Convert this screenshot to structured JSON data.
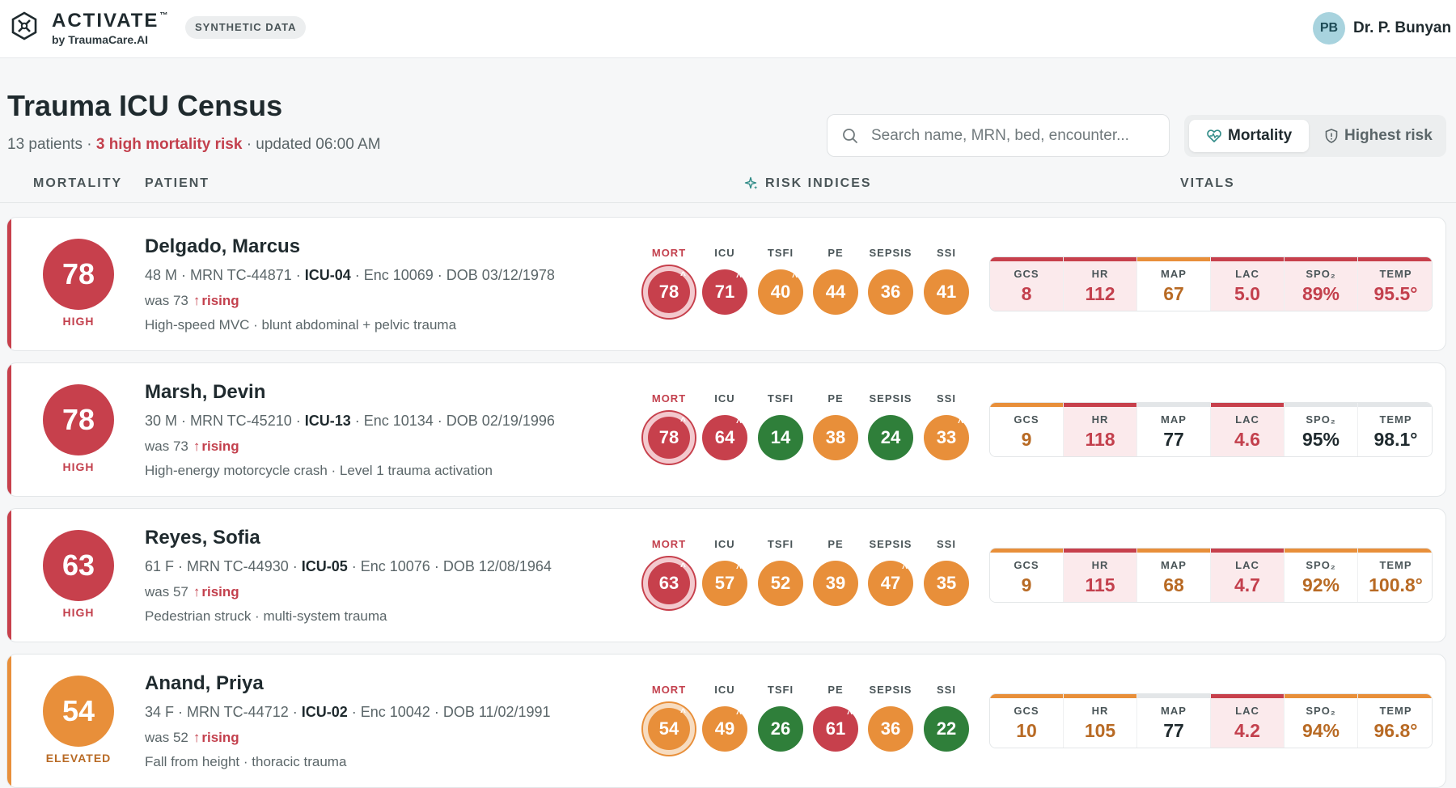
{
  "app": {
    "brand": "ACTIVATE",
    "trademark": "™",
    "brand_sub": "by TraumaCare.AI",
    "badge": "SYNTHETIC DATA"
  },
  "user": {
    "initials": "PB",
    "name": "Dr. P. Bunyan"
  },
  "page": {
    "title": "Trauma ICU Census",
    "patient_count": "13 patients",
    "sep": "·",
    "high_risk": "3 high mortality risk",
    "updated": "updated 06:00 AM"
  },
  "search": {
    "placeholder": "Search name, MRN, bed, encounter..."
  },
  "sort": {
    "mortality": "Mortality",
    "highest_risk": "Highest risk"
  },
  "columns": {
    "mortality": "MORTALITY",
    "patient": "PATIENT",
    "risk": "RISK INDICES",
    "vitals": "VITALS"
  },
  "index_labels": [
    "MORT",
    "ICU",
    "TSFI",
    "PE",
    "SEPSIS",
    "SSI"
  ],
  "vital_labels": [
    "GCS",
    "HR",
    "MAP",
    "LAC",
    "SPO₂",
    "TEMP"
  ],
  "trend_word": "rising",
  "trend_arrow": "↑",
  "colors": {
    "high": "#c7404c",
    "elevated": "#e88f3a",
    "low": "#2f7f3a",
    "neutral": "#e3e6e8",
    "tint_high": "#fbeaec",
    "text_dark": "#1f2a2e",
    "text_high": "#c3404d",
    "text_elevated": "#b86a24"
  },
  "patients": [
    {
      "score": "78",
      "level": "HIGH",
      "level_key": "high",
      "name": "Delgado, Marcus",
      "meta_pre": "48 M · MRN TC-44871 · ",
      "bed": "ICU-04",
      "meta_post": " · Enc 10069 · DOB 03/12/1978",
      "was": "was 73",
      "desc": "High-speed MVC · blunt abdominal + pelvic trauma",
      "indices": [
        {
          "v": "78",
          "c": "high",
          "up": true
        },
        {
          "v": "71",
          "c": "high",
          "up": true
        },
        {
          "v": "40",
          "c": "elevated",
          "up": true
        },
        {
          "v": "44",
          "c": "elevated",
          "up": false
        },
        {
          "v": "36",
          "c": "elevated",
          "up": false
        },
        {
          "v": "41",
          "c": "elevated",
          "up": false
        }
      ],
      "vitals": [
        {
          "v": "8",
          "s": "high"
        },
        {
          "v": "112",
          "s": "high"
        },
        {
          "v": "67",
          "s": "elevated"
        },
        {
          "v": "5.0",
          "s": "high"
        },
        {
          "v": "89%",
          "s": "high"
        },
        {
          "v": "95.5°",
          "s": "high"
        }
      ]
    },
    {
      "score": "78",
      "level": "HIGH",
      "level_key": "high",
      "name": "Marsh, Devin",
      "meta_pre": "30 M · MRN TC-45210 · ",
      "bed": "ICU-13",
      "meta_post": " · Enc 10134 · DOB 02/19/1996",
      "was": "was 73",
      "desc": "High-energy motorcycle crash · Level 1 trauma activation",
      "indices": [
        {
          "v": "78",
          "c": "high",
          "up": true
        },
        {
          "v": "64",
          "c": "high",
          "up": true
        },
        {
          "v": "14",
          "c": "low",
          "up": false
        },
        {
          "v": "38",
          "c": "elevated",
          "up": false
        },
        {
          "v": "24",
          "c": "low",
          "up": false
        },
        {
          "v": "33",
          "c": "elevated",
          "up": true
        }
      ],
      "vitals": [
        {
          "v": "9",
          "s": "elevated"
        },
        {
          "v": "118",
          "s": "high"
        },
        {
          "v": "77",
          "s": "normal"
        },
        {
          "v": "4.6",
          "s": "high"
        },
        {
          "v": "95%",
          "s": "normal"
        },
        {
          "v": "98.1°",
          "s": "normal"
        }
      ]
    },
    {
      "score": "63",
      "level": "HIGH",
      "level_key": "high",
      "name": "Reyes, Sofia",
      "meta_pre": "61 F · MRN TC-44930 · ",
      "bed": "ICU-05",
      "meta_post": " · Enc 10076 · DOB 12/08/1964",
      "was": "was 57",
      "desc": "Pedestrian struck · multi-system trauma",
      "indices": [
        {
          "v": "63",
          "c": "high",
          "up": true
        },
        {
          "v": "57",
          "c": "elevated",
          "up": true
        },
        {
          "v": "52",
          "c": "elevated",
          "up": false
        },
        {
          "v": "39",
          "c": "elevated",
          "up": false
        },
        {
          "v": "47",
          "c": "elevated",
          "up": true
        },
        {
          "v": "35",
          "c": "elevated",
          "up": false
        }
      ],
      "vitals": [
        {
          "v": "9",
          "s": "elevated"
        },
        {
          "v": "115",
          "s": "high"
        },
        {
          "v": "68",
          "s": "elevated"
        },
        {
          "v": "4.7",
          "s": "high"
        },
        {
          "v": "92%",
          "s": "elevated"
        },
        {
          "v": "100.8°",
          "s": "elevated"
        }
      ]
    },
    {
      "score": "54",
      "level": "ELEVATED",
      "level_key": "elevated",
      "name": "Anand, Priya",
      "meta_pre": "34 F · MRN TC-44712 · ",
      "bed": "ICU-02",
      "meta_post": " · Enc 10042 · DOB 11/02/1991",
      "was": "was 52",
      "desc": "Fall from height · thoracic trauma",
      "indices": [
        {
          "v": "54",
          "c": "elevated",
          "up": true
        },
        {
          "v": "49",
          "c": "elevated",
          "up": true
        },
        {
          "v": "26",
          "c": "low",
          "up": false
        },
        {
          "v": "61",
          "c": "high",
          "up": true
        },
        {
          "v": "36",
          "c": "elevated",
          "up": false
        },
        {
          "v": "22",
          "c": "low",
          "up": false
        }
      ],
      "vitals": [
        {
          "v": "10",
          "s": "elevated"
        },
        {
          "v": "105",
          "s": "elevated"
        },
        {
          "v": "77",
          "s": "normal"
        },
        {
          "v": "4.2",
          "s": "high"
        },
        {
          "v": "94%",
          "s": "elevated"
        },
        {
          "v": "96.8°",
          "s": "elevated"
        }
      ]
    }
  ]
}
